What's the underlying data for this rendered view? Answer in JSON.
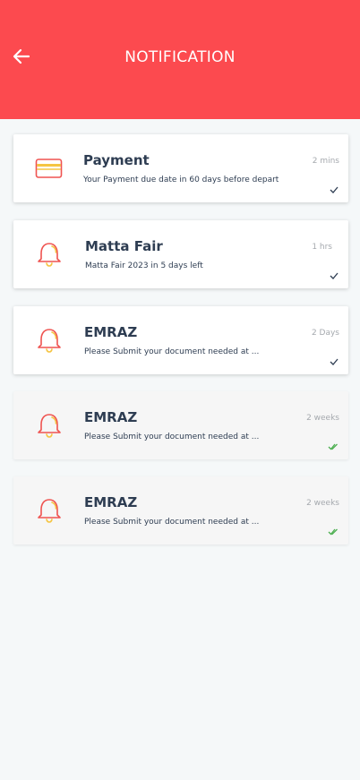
{
  "header": {
    "title": "NOTIFICATION",
    "back_icon": "arrow-left-icon",
    "color": "#fc4a4f"
  },
  "notifications": [
    {
      "title": "Payment",
      "description": "Your Payment due date in 60 days before depart",
      "time": "2 mins",
      "icon": "credit-card-icon",
      "status": "unread"
    },
    {
      "title": "Matta Fair",
      "description": "Matta Fair 2023 in 5 days left",
      "time": "1 hrs",
      "icon": "bell-icon",
      "status": "unread"
    },
    {
      "title": "EMRAZ",
      "description": "Please Submit your document needed at ...",
      "time": "2 Days",
      "icon": "bell-icon",
      "status": "unread"
    },
    {
      "title": "EMRAZ",
      "description": "Please Submit your document needed at ...",
      "time": "2 weeks",
      "icon": "bell-icon",
      "status": "read"
    },
    {
      "title": "EMRAZ",
      "description": "Please Submit your document needed at ...",
      "time": "2 weeks",
      "icon": "bell-icon",
      "status": "read"
    }
  ],
  "colors": {
    "check_unread": "#2e3d52",
    "check_read": "#4caf50",
    "icon_red": "#ef5350",
    "icon_yellow": "#f5c542"
  }
}
